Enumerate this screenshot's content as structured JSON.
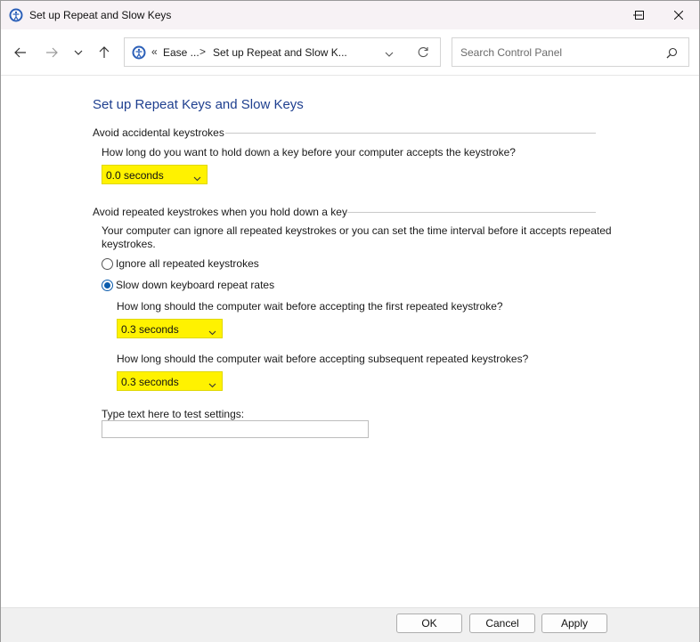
{
  "window": {
    "title": "Set up Repeat and Slow Keys",
    "icon": "ease-of-access-icon"
  },
  "nav": {
    "back": "back-arrow-icon",
    "forward": "forward-arrow-icon",
    "recent": "chevron-down-icon",
    "up": "up-arrow-icon"
  },
  "address": {
    "prefix": "«",
    "crumb1": "Ease ...",
    "separator": ">",
    "crumb2": "Set up Repeat and Slow K..."
  },
  "search": {
    "placeholder": "Search Control Panel"
  },
  "page": {
    "heading": "Set up Repeat Keys and Slow Keys",
    "group1": {
      "title": "Avoid accidental keystrokes",
      "question": "How long do you want to hold down a key before your computer accepts the keystroke?",
      "value": "0.0 seconds"
    },
    "group2": {
      "title": "Avoid repeated keystrokes when you hold down a key",
      "description_line1": "Your computer can ignore all repeated keystrokes or you can set the time interval before it accepts repeated",
      "description_line2": "keystrokes.",
      "option_ignore": "Ignore all repeated keystrokes",
      "option_slow": "Slow down keyboard repeat rates",
      "selected_option": "Slow down keyboard repeat rates",
      "first_question": "How long should the computer wait before accepting the first repeated keystroke?",
      "first_value": "0.3 seconds",
      "subsequent_question": "How long should the computer wait before accepting subsequent repeated keystrokes?",
      "subsequent_value": "0.3 seconds"
    },
    "test_label": "Type text here to test settings:",
    "test_value": ""
  },
  "buttons": {
    "ok": "OK",
    "cancel": "Cancel",
    "apply": "Apply"
  },
  "colors": {
    "heading": "#1e3f8f",
    "highlight": "#fff200",
    "radio_selected": "#0b5cad"
  }
}
